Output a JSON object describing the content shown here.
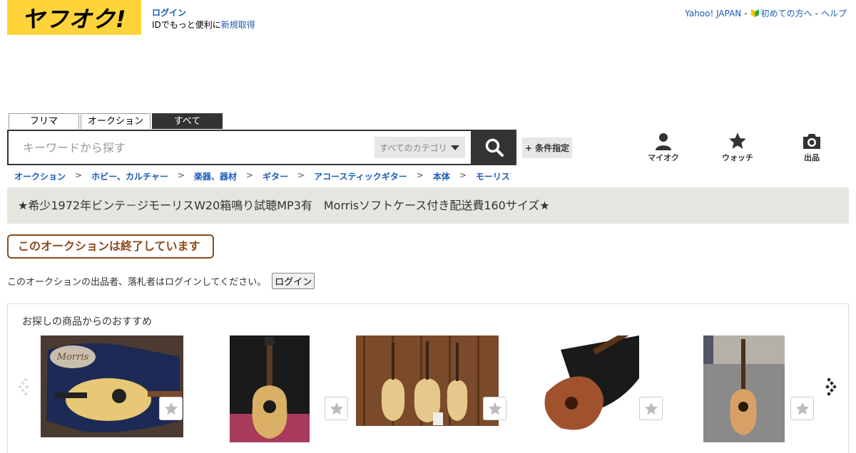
{
  "header": {
    "logo_text": "ヤフオク!",
    "login_link": "ログイン",
    "login_prompt": "IDでもっと便利に",
    "register_link": "新規取得",
    "top_links": {
      "yahoo_japan": "Yahoo! JAPAN",
      "beginners": "初めての方へ",
      "help": "ヘルプ",
      "separator": "-"
    }
  },
  "search": {
    "tabs": [
      "フリマ",
      "オークション",
      "すべて"
    ],
    "active_tab": "すべて",
    "placeholder": "キーワードから探す",
    "category_selected": "すべてのカテゴリ",
    "advanced_label": "+ 条件指定"
  },
  "nav": {
    "my_auction": "マイオク",
    "watch": "ウォッチ",
    "sell": "出品"
  },
  "breadcrumb": [
    "オークション",
    "ホビー、カルチャー",
    "楽器、器材",
    "ギター",
    "アコースティックギター",
    "本体",
    "モーリス"
  ],
  "breadcrumb_separator": ">",
  "item": {
    "title": "★希少1972年ビンテ－ジモーリスW20箱鳴り試聴MP3有　Morrisソフトケース付き配送費160サイズ★",
    "status_badge": "このオークションは終了しています",
    "login_message": "このオークションの出品者、落札者はログインしてください。",
    "login_button": "ログイン"
  },
  "recommendations": {
    "title": "お探しの商品からのおすすめ",
    "case_logo_text": "Morris",
    "items": [
      {
        "image": "morris-guitar-in-blue-case"
      },
      {
        "image": "acoustic-guitar-on-red-backdrop"
      },
      {
        "image": "three-guitars-on-wall"
      },
      {
        "image": "sunburst-guitar-on-hard-case"
      },
      {
        "image": "guitar-on-street"
      }
    ]
  },
  "colors": {
    "brand_yellow": "#ffd43b",
    "link_blue": "#1a5cb5",
    "ended_brown": "#8b4a1c",
    "title_bg": "#e6e5e0",
    "dark": "#333333"
  }
}
